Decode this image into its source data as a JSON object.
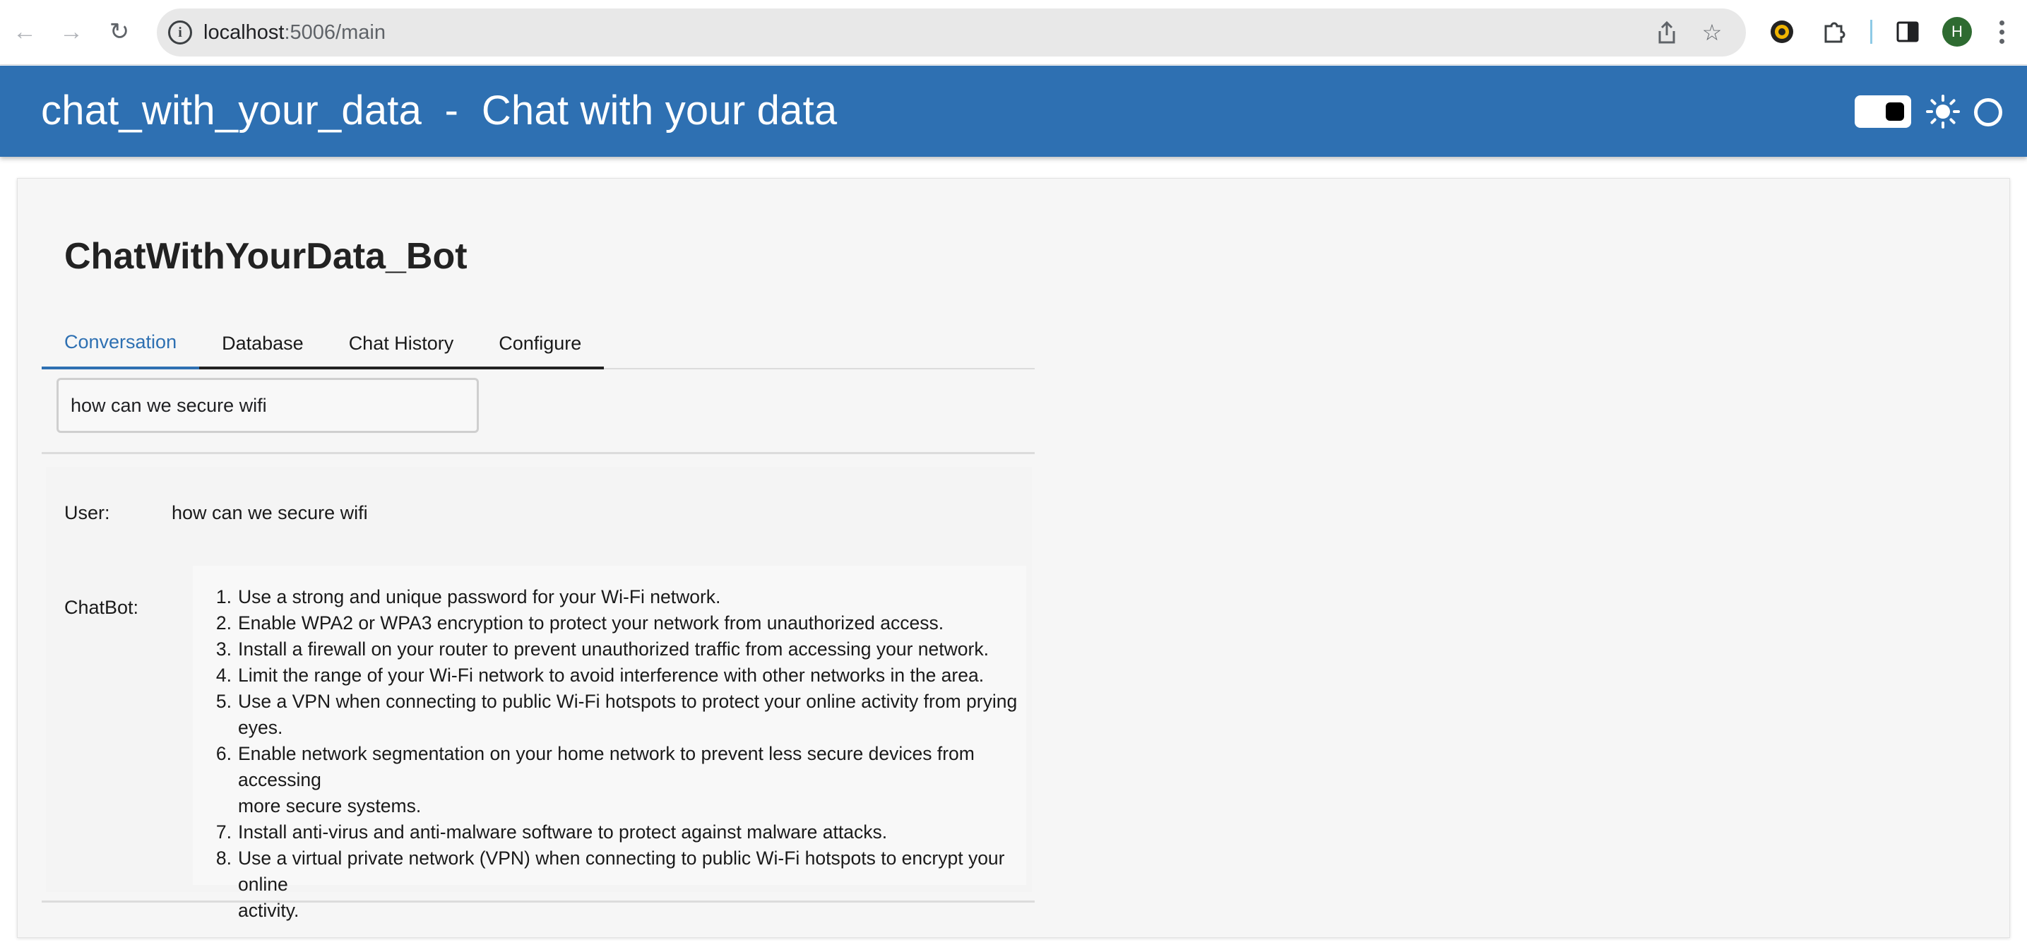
{
  "browser": {
    "url_host": "localhost",
    "url_path": ":5006/main",
    "profile_initial": "H"
  },
  "header": {
    "title": "chat_with_your_data  -  Chat with your data"
  },
  "main": {
    "bot_title": "ChatWithYourData_Bot",
    "tabs": [
      {
        "label": "Conversation"
      },
      {
        "label": "Database"
      },
      {
        "label": "Chat History"
      },
      {
        "label": "Configure"
      }
    ],
    "query_value": "how can we secure wifi",
    "conversation": {
      "user_label": "User:",
      "user_message": "how can we secure wifi",
      "bot_label": "ChatBot:",
      "bot_items": [
        {
          "num": "1.",
          "lines": [
            "Use a strong and unique password for your Wi-Fi network."
          ]
        },
        {
          "num": "2.",
          "lines": [
            "Enable WPA2 or WPA3 encryption to protect your network from unauthorized access."
          ]
        },
        {
          "num": "3.",
          "lines": [
            "Install a firewall on your router to prevent unauthorized traffic from accessing your network."
          ]
        },
        {
          "num": "4.",
          "lines": [
            "Limit the range of your Wi-Fi network to avoid interference with other networks in the area."
          ]
        },
        {
          "num": "5.",
          "lines": [
            "Use a VPN when connecting to public Wi-Fi hotspots to protect your online activity from prying",
            "eyes."
          ]
        },
        {
          "num": "6.",
          "lines": [
            "Enable network segmentation on your home network to prevent less secure devices from accessing",
            "more secure systems."
          ]
        },
        {
          "num": "7.",
          "lines": [
            "Install anti-virus and anti-malware software to protect against malware attacks."
          ]
        },
        {
          "num": "8.",
          "lines": [
            "Use a virtual private network (VPN) when connecting to public Wi-Fi hotspots to encrypt your online",
            "activity."
          ]
        }
      ]
    }
  },
  "colors": {
    "header_bg": "#2e70b2",
    "active_tab": "#2e70b2"
  }
}
